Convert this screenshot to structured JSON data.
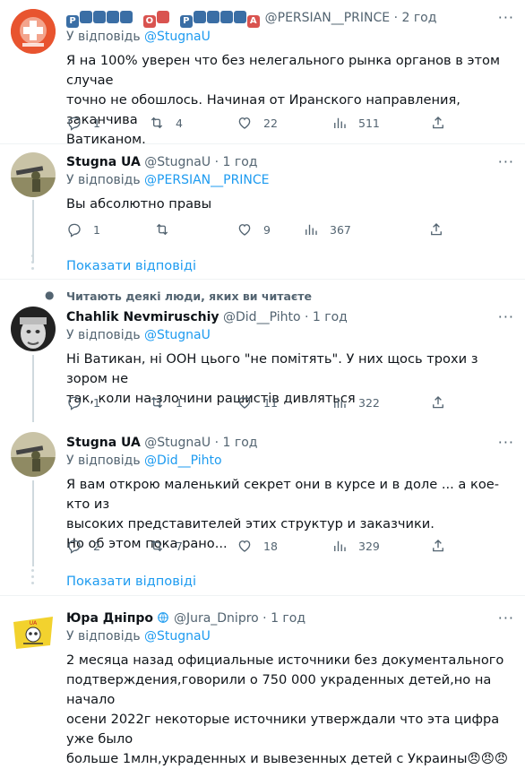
{
  "tweets": [
    {
      "display_name": "🅿️🅾️🆁🆂🅸🅰️🅽 🅾️🅵 🅿️🆁🅸🅽🅲🅴",
      "handle": "@PERSIAN__PRINCE",
      "sep": "·",
      "time": "2 год",
      "reply_prefix": "У відповідь",
      "reply_handle": "@StugnaU",
      "text_lines": [
        "Я на 100% уверен что без нелегального рынка органов в этом случае",
        "точно не обошлось. Начиная от Иранского направления, заканчива",
        "Ватиканом."
      ],
      "replies": "1",
      "retweets": "4",
      "likes": "22",
      "views": "511"
    },
    {
      "display_name": "Stugna UA",
      "handle": "@StugnaU",
      "sep": "·",
      "time": "1 год",
      "reply_prefix": "У відповідь",
      "reply_handle": "@PERSIAN__PRINCE",
      "text_lines": [
        "Вы абсолютно правы"
      ],
      "replies": "1",
      "retweets": "",
      "likes": "9",
      "views": "367"
    },
    {
      "display_name": "Chahlik Nevmiruschiy",
      "handle": "@Did__Pihto",
      "sep": "·",
      "time": "1 год",
      "reply_prefix": "У відповідь",
      "reply_handle": "@StugnaU",
      "text_lines": [
        "Ні Ватикан,  ні ООН цього \"не помітять\". У них щось трохи з зором не",
        "так, коли на злочини рашистів дивляться"
      ],
      "replies": "1",
      "retweets": "1",
      "likes": "11",
      "views": "322"
    },
    {
      "display_name": "Stugna UA",
      "handle": "@StugnaU",
      "sep": "·",
      "time": "1 год",
      "reply_prefix": "У відповідь",
      "reply_handle": "@Did__Pihto",
      "text_lines": [
        "Я вам открою маленький секрет они в курсе и в доле ... а кое-кто из",
        "высоких представителей этих структур и заказчики.",
        "Но об этом пока рано..."
      ],
      "replies": "2",
      "retweets": "7",
      "likes": "18",
      "views": "329"
    },
    {
      "display_name": "Юра Дніпро",
      "handle": "@Jura_Dnipro",
      "sep": "·",
      "time": "1 год",
      "reply_prefix": "У відповідь",
      "reply_handle": "@StugnaU",
      "text_lines": [
        "2 месяца назад официальные источники без документального",
        "подтверждения,говорили о 750 000 украденных детей,но на начало",
        "осени 2022г некоторые источники утверждали что эта цифра уже было",
        "больше 1млн,украденных и вывезенных детей с Украины"
      ],
      "replies": "",
      "retweets": "",
      "likes": "",
      "views": ""
    }
  ],
  "show_replies": "Показати відповіді",
  "social_context": "Читають деякі люди, яких ви читаєте",
  "more_label": "···",
  "emoji_label": "😠😠😠",
  "colors": {
    "link": "#1d9bf0",
    "secondary": "#536471",
    "divider": "#eff3f4",
    "thread": "#cfd9de"
  }
}
